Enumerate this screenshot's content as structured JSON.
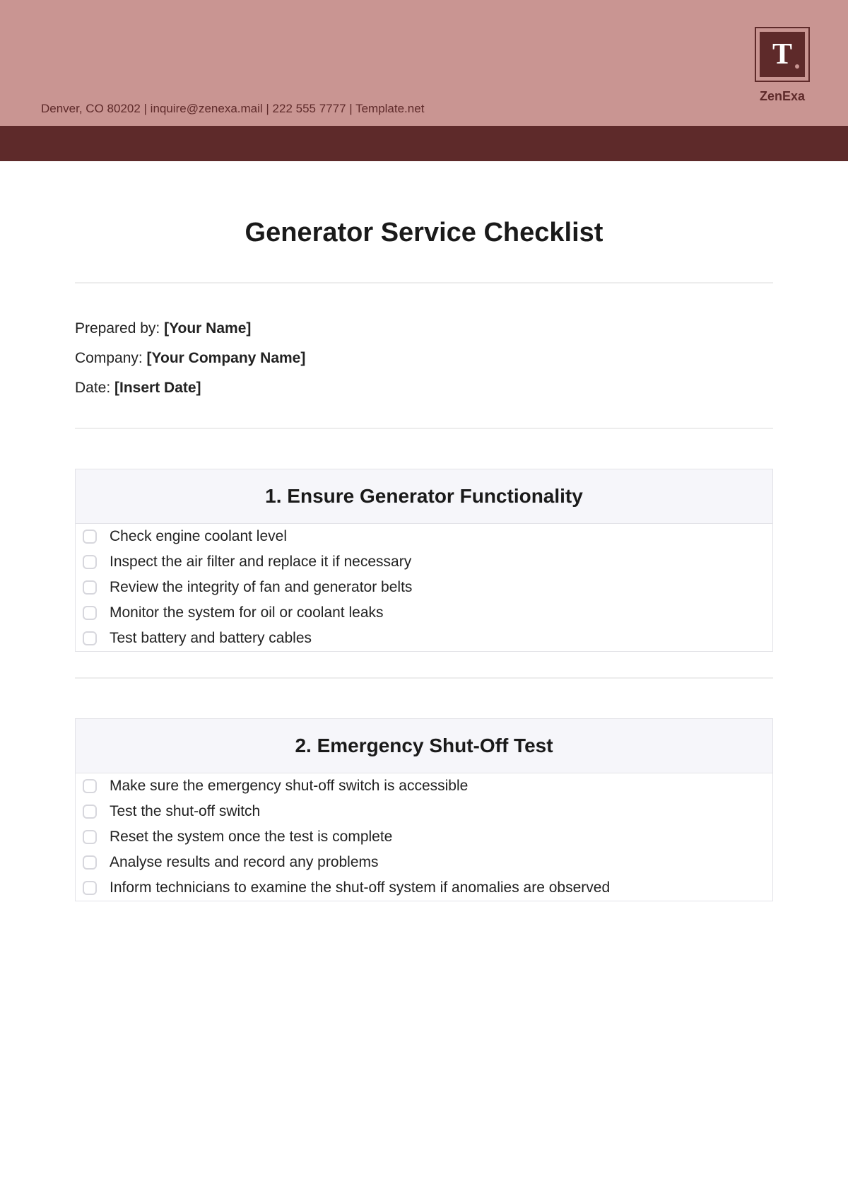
{
  "header": {
    "contact": "Denver, CO 80202 | inquire@zenexa.mail | 222 555 7777 | Template.net",
    "logo_letter": "T",
    "brand": "ZenExa"
  },
  "title": "Generator Service Checklist",
  "meta": {
    "prepared_by_label": "Prepared by: ",
    "prepared_by_value": "[Your Name]",
    "company_label": "Company: ",
    "company_value": "[Your Company Name]",
    "date_label": "Date: ",
    "date_value": "[Insert Date]"
  },
  "sections": [
    {
      "heading": "1. Ensure Generator Functionality",
      "items": [
        "Check engine coolant level",
        "Inspect the air filter and replace it if necessary",
        "Review the integrity of fan and generator belts",
        "Monitor the system for oil or coolant leaks",
        "Test battery and battery cables"
      ]
    },
    {
      "heading": "2. Emergency Shut-Off Test",
      "items": [
        "Make sure the emergency shut-off switch is accessible",
        "Test the shut-off switch",
        "Reset the system once the test is complete",
        "Analyse results and record any problems",
        "Inform technicians to examine the shut-off system if anomalies are observed"
      ]
    }
  ]
}
